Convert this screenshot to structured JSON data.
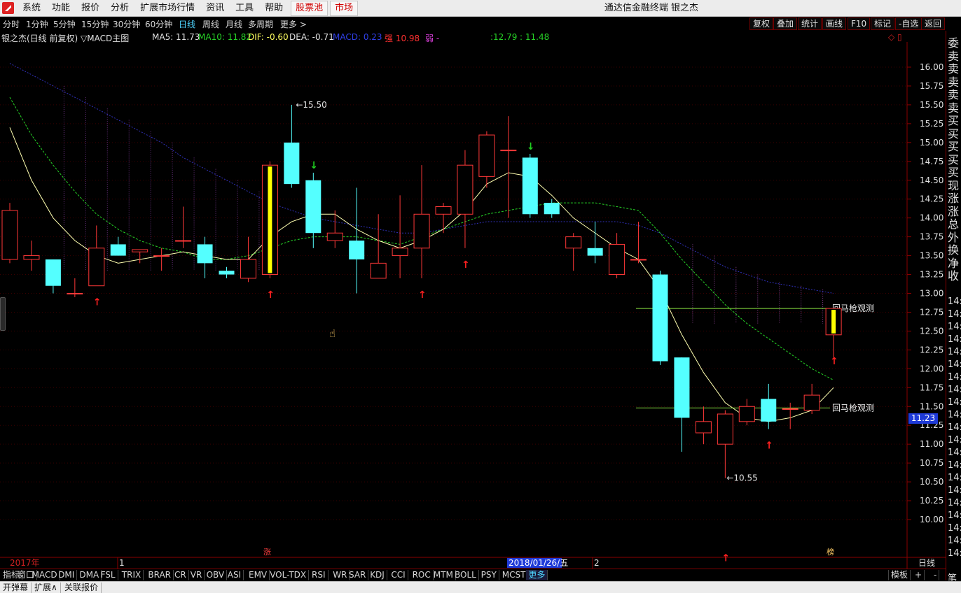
{
  "app": {
    "menu": [
      "系统",
      "功能",
      "报价",
      "分析",
      "扩展市场行情",
      "资讯",
      "工具",
      "帮助"
    ],
    "menu_red": [
      "股票池",
      "市场"
    ],
    "title": "通达信金融终端 银之杰"
  },
  "periods": [
    "分时",
    "1分钟",
    "5分钟",
    "15分钟",
    "30分钟",
    "60分钟",
    "日线",
    "周线",
    "月线",
    "多周期",
    "更多 >"
  ],
  "active_period": "日线",
  "right_buttons": [
    "复权",
    "叠加",
    "统计",
    "画线",
    "F10",
    "标记",
    "-自选",
    "返回"
  ],
  "info": {
    "stock": "银之杰(日线 前复权) ▽MACD主图",
    "ma5": "MA5: 11.73",
    "ma10": "MA10: 11.82",
    "dif": "DIF: -0.60",
    "dea": "DEA: -0.71",
    "macd": "MACD: 0.23",
    "strong": "强 10.98",
    "weak": "弱 -",
    "v1": ":12.79",
    "v2": ": 11.48"
  },
  "colors": {
    "up": "#ff3838",
    "down": "#54ffff",
    "ma5": "#ffffb0",
    "ma10": "#26d226",
    "ma_long": "#3030b8",
    "yellow": "#ffff00",
    "hline": "#88e040",
    "axis": "#8b0000"
  },
  "y_axis": {
    "labels": [
      "16.00",
      "15.75",
      "15.50",
      "15.25",
      "15.00",
      "14.75",
      "14.50",
      "14.25",
      "14.00",
      "13.75",
      "13.50",
      "13.25",
      "13.00",
      "12.75",
      "12.50",
      "12.25",
      "12.00",
      "11.75",
      "11.50",
      "11.25",
      "11.00",
      "10.75",
      "10.50",
      "10.25",
      "10.00"
    ],
    "current_price": "11.23",
    "tf": "日线"
  },
  "annotations": {
    "high": "15.50",
    "low": "10.55",
    "signal_label": "回马枪观测",
    "marker_rise": "涨",
    "marker_end": "榜"
  },
  "x_axis": {
    "year": "2017年",
    "m1": "1",
    "date": "2018/01/26/五",
    "m2": "2"
  },
  "chart_data": {
    "type": "candlestick",
    "ylim": [
      9.8,
      16.2
    ],
    "candles": [
      {
        "o": 13.45,
        "h": 14.2,
        "l": 13.4,
        "c": 14.1
      },
      {
        "o": 13.45,
        "h": 13.7,
        "l": 13.3,
        "c": 13.5
      },
      {
        "o": 13.45,
        "h": 13.45,
        "l": 13.0,
        "c": 13.1
      },
      {
        "o": 13.0,
        "h": 13.2,
        "l": 12.95,
        "c": 13.0
      },
      {
        "o": 13.1,
        "h": 13.9,
        "l": 13.1,
        "c": 13.6
      },
      {
        "o": 13.65,
        "h": 13.75,
        "l": 13.5,
        "c": 13.5
      },
      {
        "o": 13.55,
        "h": 13.58,
        "l": 13.4,
        "c": 13.58
      },
      {
        "o": 13.5,
        "h": 13.6,
        "l": 13.3,
        "c": 13.5
      },
      {
        "o": 13.7,
        "h": 14.15,
        "l": 13.6,
        "c": 13.7
      },
      {
        "o": 13.65,
        "h": 13.75,
        "l": 13.2,
        "c": 13.4
      },
      {
        "o": 13.3,
        "h": 13.35,
        "l": 13.2,
        "c": 13.25
      },
      {
        "o": 13.2,
        "h": 13.75,
        "l": 13.15,
        "c": 13.45
      },
      {
        "o": 13.25,
        "h": 14.75,
        "l": 13.2,
        "c": 14.7
      },
      {
        "o": 15.0,
        "h": 15.5,
        "l": 14.4,
        "c": 14.45
      },
      {
        "o": 14.5,
        "h": 14.6,
        "l": 13.6,
        "c": 13.8
      },
      {
        "o": 13.7,
        "h": 14.1,
        "l": 13.6,
        "c": 13.8
      },
      {
        "o": 13.7,
        "h": 14.4,
        "l": 13.0,
        "c": 13.45
      },
      {
        "o": 13.2,
        "h": 14.05,
        "l": 13.2,
        "c": 13.4
      },
      {
        "o": 13.5,
        "h": 14.3,
        "l": 13.2,
        "c": 13.6
      },
      {
        "o": 13.6,
        "h": 14.7,
        "l": 13.2,
        "c": 14.05
      },
      {
        "o": 14.05,
        "h": 14.2,
        "l": 13.8,
        "c": 14.15
      },
      {
        "o": 14.05,
        "h": 14.9,
        "l": 13.6,
        "c": 14.7
      },
      {
        "o": 14.55,
        "h": 15.15,
        "l": 14.4,
        "c": 15.1
      },
      {
        "o": 14.9,
        "h": 15.35,
        "l": 14.0,
        "c": 14.9
      },
      {
        "o": 14.8,
        "h": 14.85,
        "l": 14.0,
        "c": 14.05
      },
      {
        "o": 14.2,
        "h": 14.25,
        "l": 14.0,
        "c": 14.05
      },
      {
        "o": 13.6,
        "h": 13.8,
        "l": 13.3,
        "c": 13.75
      },
      {
        "o": 13.6,
        "h": 13.95,
        "l": 13.4,
        "c": 13.5
      },
      {
        "o": 13.25,
        "h": 13.8,
        "l": 13.2,
        "c": 13.65
      },
      {
        "o": 13.45,
        "h": 13.95,
        "l": 13.4,
        "c": 13.45
      },
      {
        "o": 13.25,
        "h": 13.3,
        "l": 12.05,
        "c": 12.1
      },
      {
        "o": 12.15,
        "h": 12.15,
        "l": 10.9,
        "c": 11.35
      },
      {
        "o": 11.15,
        "h": 11.5,
        "l": 11.0,
        "c": 11.3
      },
      {
        "o": 11.0,
        "h": 11.45,
        "l": 10.55,
        "c": 11.4
      },
      {
        "o": 11.3,
        "h": 11.6,
        "l": 11.25,
        "c": 11.5
      },
      {
        "o": 11.6,
        "h": 11.8,
        "l": 11.2,
        "c": 11.3
      },
      {
        "o": 11.47,
        "h": 11.55,
        "l": 11.2,
        "c": 11.47
      },
      {
        "o": 11.45,
        "h": 11.8,
        "l": 11.4,
        "c": 11.65
      },
      {
        "o": 12.45,
        "h": 12.8,
        "l": 12.15,
        "c": 12.8
      }
    ],
    "ma5": [
      15.2,
      14.5,
      14.0,
      13.7,
      13.5,
      13.4,
      13.45,
      13.5,
      13.55,
      13.5,
      13.45,
      13.45,
      13.75,
      13.95,
      14.05,
      14.05,
      13.85,
      13.7,
      13.6,
      13.7,
      13.85,
      14.1,
      14.45,
      14.6,
      14.55,
      14.3,
      14.0,
      13.8,
      13.6,
      13.45,
      13.05,
      12.45,
      11.95,
      11.55,
      11.35,
      11.3,
      11.35,
      11.45,
      11.75
    ],
    "ma10": [
      15.6,
      15.1,
      14.7,
      14.35,
      14.05,
      13.85,
      13.7,
      13.6,
      13.55,
      13.45,
      13.45,
      13.5,
      13.6,
      13.7,
      13.75,
      13.75,
      13.75,
      13.7,
      13.65,
      13.75,
      13.85,
      13.95,
      14.05,
      14.1,
      14.15,
      14.2,
      14.2,
      14.2,
      14.15,
      14.1,
      13.8,
      13.45,
      13.15,
      12.85,
      12.6,
      12.4,
      12.2,
      12.0,
      11.85
    ],
    "ma_long": [
      16.05,
      15.9,
      15.75,
      15.6,
      15.45,
      15.3,
      15.15,
      15.0,
      14.8,
      14.65,
      14.5,
      14.35,
      14.2,
      14.1,
      14.0,
      13.95,
      13.9,
      13.85,
      13.8,
      13.8,
      13.85,
      13.9,
      13.95,
      13.95,
      13.95,
      13.95,
      13.95,
      13.95,
      13.95,
      13.9,
      13.8,
      13.65,
      13.5,
      13.35,
      13.25,
      13.15,
      13.1,
      13.05,
      13.0
    ],
    "up_arrows": [
      4,
      12,
      19,
      21,
      35,
      38
    ],
    "down_arrows": [
      14,
      24
    ],
    "signal_lines": [
      12.8,
      11.48
    ]
  }
}
